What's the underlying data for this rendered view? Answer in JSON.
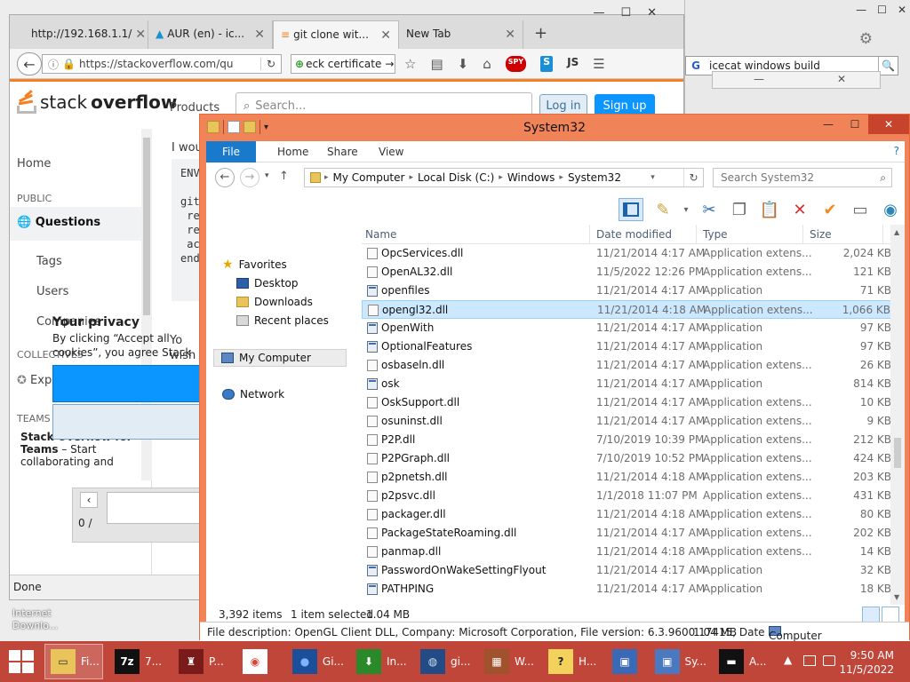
{
  "bg_browser": {
    "win_buttons": [
      "—",
      "☐",
      "✕"
    ],
    "google_search_value": "icecat windows build",
    "dialog_buttons": [
      "—",
      "✕"
    ]
  },
  "browser": {
    "tabs": [
      {
        "label": "http://192.168.1.1/"
      },
      {
        "label": "AUR (en) - ic..."
      },
      {
        "label": "git clone wit...",
        "active": true
      },
      {
        "label": "New Tab"
      }
    ],
    "url": "https://stackoverflow.com/qu",
    "search_value": "eck certificate",
    "status": "Done",
    "win_buttons": [
      "—",
      "☐",
      "✕"
    ]
  },
  "stackoverflow": {
    "logo_stack": "stack",
    "logo_overflow": "overflow",
    "products": "Products",
    "search_placeholder": "Search...",
    "login": "Log in",
    "signup": "Sign up",
    "nav": {
      "home": "Home",
      "public": "PUBLIC",
      "questions": "Questions",
      "tags": "Tags",
      "users": "Users",
      "companies": "Companies",
      "collectives": "COLLECTIVES",
      "explore": "Exp",
      "teams": "TEAMS",
      "teams_title": "Stack Overflow for Teams",
      "teams_text": "– Start collaborating and"
    },
    "body_text": "I wou",
    "code_lines": [
      "ENV",
      "",
      "git",
      " re",
      " re",
      " ac",
      "end"
    ],
    "privacy_title": "Your privacy",
    "privacy_text": "By clicking “Accept all cookies”, you agree Stack Exchange can store cookies on your device and disclose information in accordance w",
    "note_line1": "Yo",
    "note_line2": "wish",
    "page_label": "0 /"
  },
  "desktop_label": "Internet Downlo...",
  "explorer": {
    "title": "System32",
    "ribbon_tabs": [
      "File",
      "Home",
      "Share",
      "View"
    ],
    "breadcrumb": [
      "My Computer",
      "Local Disk (C:)",
      "Windows",
      "System32"
    ],
    "search_placeholder": "Search System32",
    "nav": {
      "favorites": "Favorites",
      "desktop": "Desktop",
      "downloads": "Downloads",
      "recent": "Recent places",
      "my_computer": "My Computer",
      "network": "Network"
    },
    "columns": {
      "name": "Name",
      "date": "Date modified",
      "type": "Type",
      "size": "Size"
    },
    "files": [
      {
        "name": "OpcServices.dll",
        "date": "11/21/2014 4:17 AM",
        "type": "Application extens...",
        "size": "2,024 KB",
        "kind": "dll"
      },
      {
        "name": "OpenAL32.dll",
        "date": "11/5/2022 12:26 PM",
        "type": "Application extens...",
        "size": "121 KB",
        "kind": "dll"
      },
      {
        "name": "openfiles",
        "date": "11/21/2014 4:17 AM",
        "type": "Application",
        "size": "71 KB",
        "kind": "app"
      },
      {
        "name": "opengl32.dll",
        "date": "11/21/2014 4:18 AM",
        "type": "Application extens...",
        "size": "1,066 KB",
        "kind": "dll",
        "selected": true
      },
      {
        "name": "OpenWith",
        "date": "11/21/2014 4:17 AM",
        "type": "Application",
        "size": "97 KB",
        "kind": "app"
      },
      {
        "name": "OptionalFeatures",
        "date": "11/21/2014 4:17 AM",
        "type": "Application",
        "size": "97 KB",
        "kind": "app"
      },
      {
        "name": "osbaseln.dll",
        "date": "11/21/2014 4:17 AM",
        "type": "Application extens...",
        "size": "26 KB",
        "kind": "dll"
      },
      {
        "name": "osk",
        "date": "11/21/2014 4:17 AM",
        "type": "Application",
        "size": "814 KB",
        "kind": "app"
      },
      {
        "name": "OskSupport.dll",
        "date": "11/21/2014 4:17 AM",
        "type": "Application extens...",
        "size": "10 KB",
        "kind": "dll"
      },
      {
        "name": "osuninst.dll",
        "date": "11/21/2014 4:17 AM",
        "type": "Application extens...",
        "size": "9 KB",
        "kind": "dll"
      },
      {
        "name": "P2P.dll",
        "date": "7/10/2019 10:39 PM",
        "type": "Application extens...",
        "size": "212 KB",
        "kind": "dll"
      },
      {
        "name": "P2PGraph.dll",
        "date": "7/10/2019 10:52 PM",
        "type": "Application extens...",
        "size": "424 KB",
        "kind": "dll"
      },
      {
        "name": "p2pnetsh.dll",
        "date": "11/21/2014 4:18 AM",
        "type": "Application extens...",
        "size": "203 KB",
        "kind": "dll"
      },
      {
        "name": "p2psvc.dll",
        "date": "1/1/2018 11:07 PM",
        "type": "Application extens...",
        "size": "431 KB",
        "kind": "dll"
      },
      {
        "name": "packager.dll",
        "date": "11/21/2014 4:18 AM",
        "type": "Application extens...",
        "size": "80 KB",
        "kind": "dll"
      },
      {
        "name": "PackageStateRoaming.dll",
        "date": "11/21/2014 4:17 AM",
        "type": "Application extens...",
        "size": "202 KB",
        "kind": "dll"
      },
      {
        "name": "panmap.dll",
        "date": "11/21/2014 4:18 AM",
        "type": "Application extens...",
        "size": "14 KB",
        "kind": "dll"
      },
      {
        "name": "PasswordOnWakeSettingFlyout",
        "date": "11/21/2014 4:17 AM",
        "type": "Application",
        "size": "32 KB",
        "kind": "app"
      },
      {
        "name": "PATHPING",
        "date": "11/21/2014 4:17 AM",
        "type": "Application",
        "size": "18 KB",
        "kind": "app"
      }
    ],
    "status": {
      "items": "3,392 items",
      "selected": "1 item selected",
      "size": "1.04 MB"
    },
    "description": "File description: OpenGL Client DLL, Company: Microsoft Corporation, File version: 6.3.9600.17415, Date",
    "description_size": "1.04 MB",
    "description_location": "Computer"
  },
  "taskbar": {
    "items": [
      {
        "label": "Fi...",
        "icon": "folder-icon",
        "active": true
      },
      {
        "label": "7...",
        "icon": "7zip-icon"
      },
      {
        "label": "P...",
        "icon": "game-icon"
      },
      {
        "label": "",
        "icon": "chrome-icon"
      },
      {
        "label": "Gi...",
        "icon": "globe-icon"
      },
      {
        "label": "In...",
        "icon": "download-icon"
      },
      {
        "label": "gi...",
        "icon": "browser-icon"
      },
      {
        "label": "W...",
        "icon": "firewall-icon"
      },
      {
        "label": "H...",
        "icon": "help-icon"
      },
      {
        "label": "",
        "icon": "monitor-icon"
      },
      {
        "label": "Sy...",
        "icon": "system-icon"
      },
      {
        "label": "A...",
        "icon": "terminal-icon"
      }
    ],
    "time": "9:50 AM",
    "date": "11/5/2022"
  },
  "colors": {
    "explorer_frame": "#f08458",
    "taskbar": "#c0463a",
    "so_orange": "#f48024",
    "so_blue": "#0a95ff"
  }
}
